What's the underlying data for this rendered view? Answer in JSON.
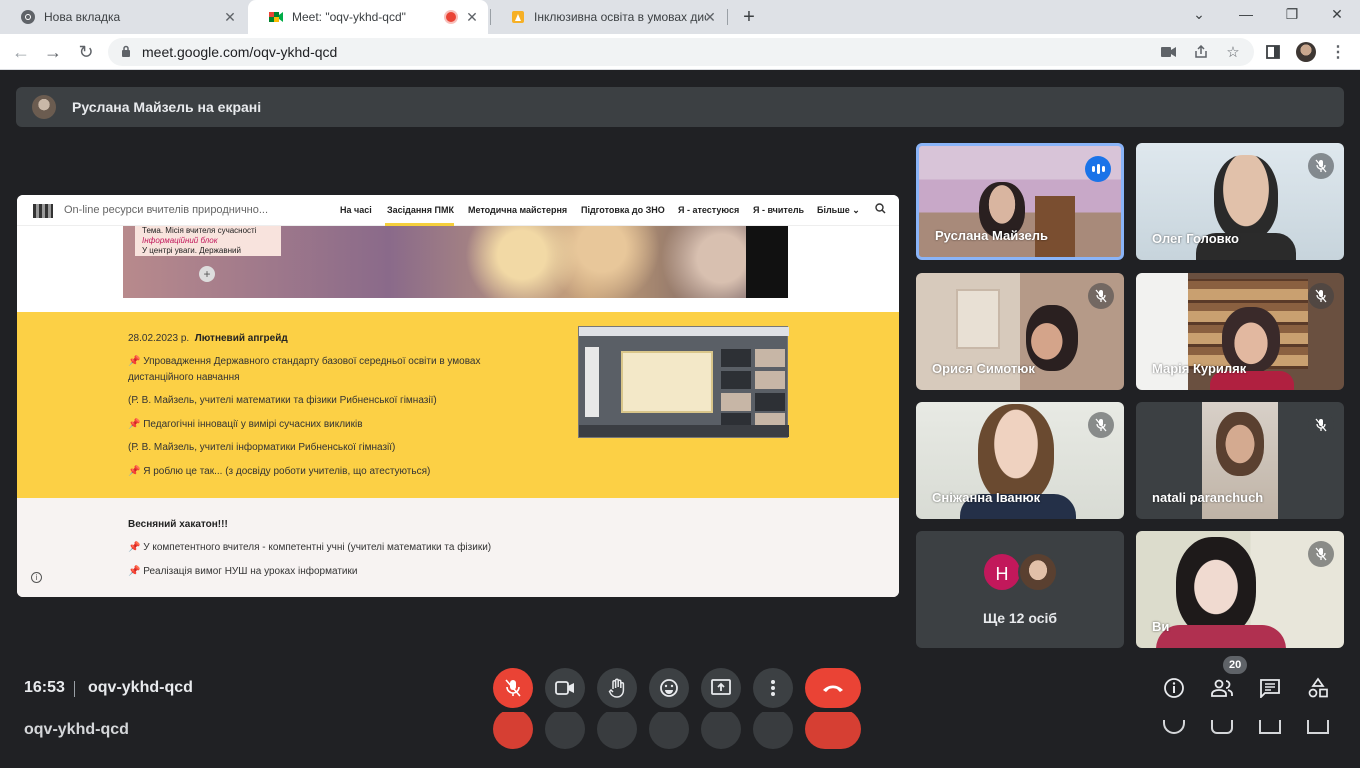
{
  "browser": {
    "tabs": [
      {
        "title": "Нова вкладка"
      },
      {
        "title": "Meet: \"oqv-ykhd-qcd\""
      },
      {
        "title": "Інклюзивна освіта в умовах дис"
      }
    ],
    "url": "meet.google.com/oqv-ykhd-qcd"
  },
  "presentation": {
    "banner": "Руслана Майзель на екрані"
  },
  "site": {
    "title": "On-line ресурси вчителів природнично...",
    "nav": [
      "На часі",
      "Засідання ПМК",
      "Методична майстерня",
      "Підготовка до ЗНО",
      "Я - атестуюся",
      "Я - вчитель",
      "Більше"
    ],
    "note": [
      "Тема. Місія вчителя сучасності",
      "Інформаційний блок",
      "У центрі уваги. Державний"
    ],
    "section1": {
      "date": "28.02.2023 р.",
      "title": "Лютневий апгрейд",
      "lines": [
        "📌 Упровадження Державного стандарту базової середньої освіти в умовах",
        "дистанційного навчання",
        "(Р. В. Майзель, учителі математики та фізики Рибненської гімназії)",
        "📌 Педагогічні інновації у вимірі сучасних викликів",
        "(Р. В. Майзель, учителі інформатики Рибненської гімназії)",
        "📌 Я роблю це так... (з досвіду роботи учителів, що атестуються)"
      ]
    },
    "section2": {
      "title": "Весняний хакатон!!!",
      "lines": [
        "📌 У компетентного вчителя - компетентні учні (учителі математики та фізики)",
        "📌 Реалізація вимог НУШ на уроках інформатики"
      ]
    }
  },
  "participants": [
    {
      "name": "Руслана Майзель",
      "speaking": true
    },
    {
      "name": "Олег Головко",
      "muted": true
    },
    {
      "name": "Орися Симотюк",
      "muted": true
    },
    {
      "name": "Марія Куриляк",
      "muted": true
    },
    {
      "name": "Сніжанна Іванюк",
      "muted": true
    },
    {
      "name": "natali paranchuch",
      "muted": true
    },
    {
      "name": "Ви",
      "muted": true
    }
  ],
  "more_tile": {
    "initial": "Н",
    "label": "Ще 12 осіб"
  },
  "meeting": {
    "time": "16:53",
    "code": "oqv-ykhd-qcd",
    "participant_count": "20"
  },
  "colors": {
    "meet_bg": "#202124",
    "end_call": "#ea4335",
    "yellow_band": "#fcd045",
    "speaking": "#1a73e8"
  }
}
